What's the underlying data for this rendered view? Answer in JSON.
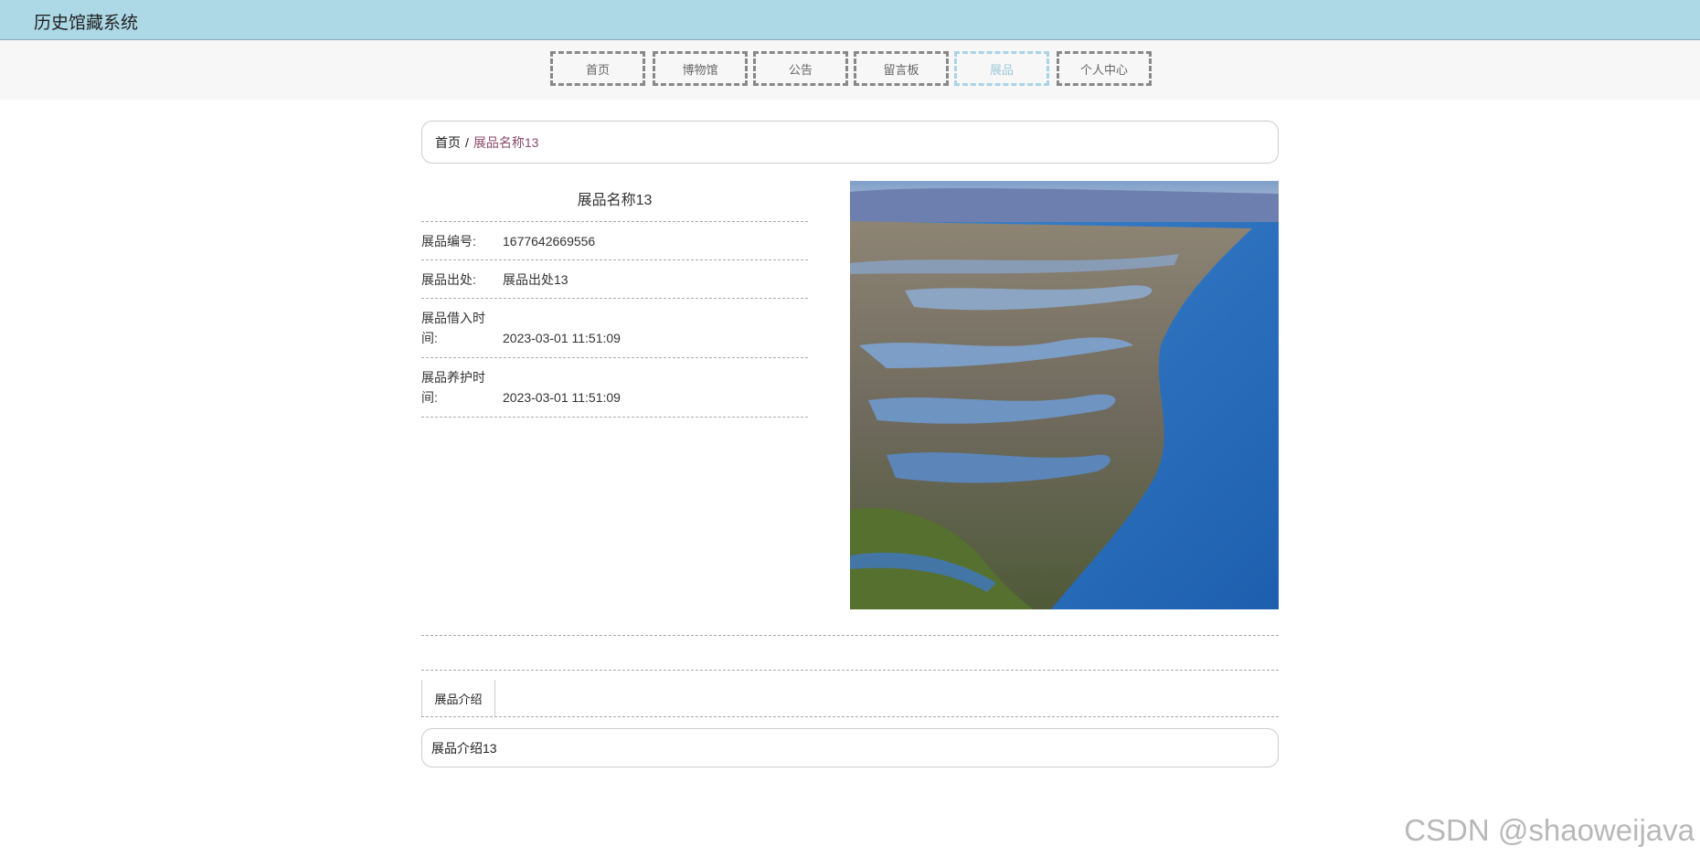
{
  "app": {
    "title": "历史馆藏系统"
  },
  "nav": {
    "items": [
      {
        "label": "首页"
      },
      {
        "label": "博物馆"
      },
      {
        "label": "公告"
      },
      {
        "label": "留言板"
      },
      {
        "label": "展品"
      },
      {
        "label": "个人中心"
      }
    ],
    "active": "展品"
  },
  "breadcrumb": {
    "home": "首页",
    "separator": "/",
    "current": "展品名称13"
  },
  "exhibit": {
    "name": "展品名称13",
    "fields": [
      {
        "label": "展品编号:",
        "value": "1677642669556"
      },
      {
        "label": "展品出处:",
        "value": "展品出处13"
      },
      {
        "label": "展品借入时间:",
        "value": "2023-03-01 11:51:09"
      },
      {
        "label": "展品养护时间:",
        "value": "2023-03-01 11:51:09"
      }
    ]
  },
  "tabs": [
    {
      "label": "展品介绍"
    }
  ],
  "intro": {
    "text": "展品介绍13"
  },
  "watermark": "CSDN @shaoweijava",
  "colors": {
    "topbar": "#add8e6",
    "active_nav": "#a8d4e6",
    "breadcrumb_current": "#8a4a6a"
  }
}
